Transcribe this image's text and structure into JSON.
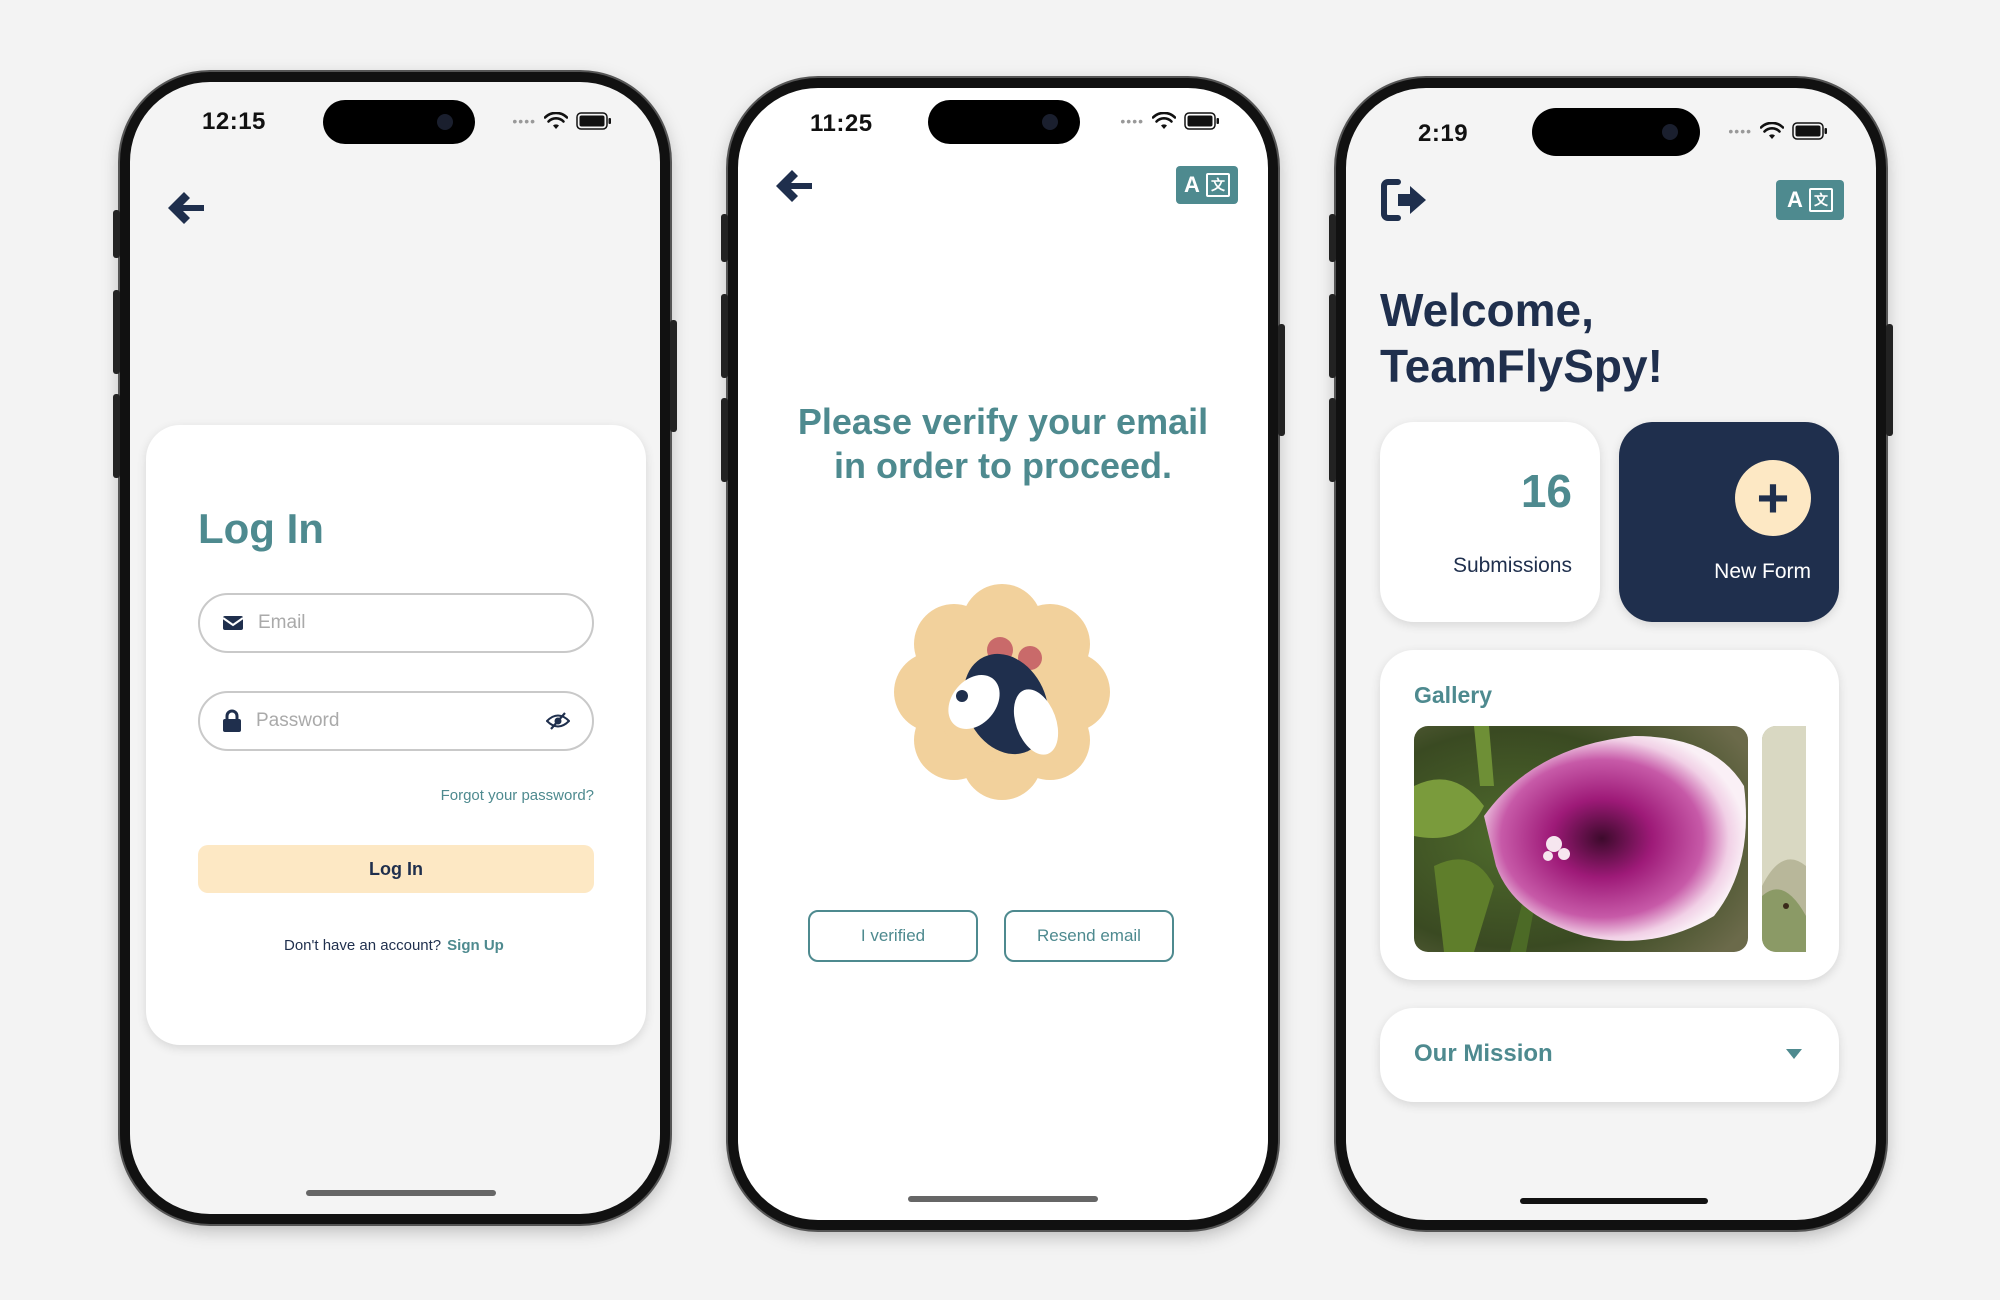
{
  "colors": {
    "teal": "#4e8a8f",
    "navy": "#1f2f4d",
    "cream": "#fde8c4",
    "page_bg": "#f3f3f3"
  },
  "login_screen": {
    "status_time": "12:15",
    "back_icon": "arrow-left-icon",
    "title": "Log In",
    "email_placeholder": "Email",
    "password_placeholder": "Password",
    "forgot_password": "Forgot your password?",
    "login_button": "Log In",
    "no_account_text": "Don't have an account?",
    "sign_up_link": "Sign Up"
  },
  "verify_screen": {
    "status_time": "11:25",
    "back_icon": "arrow-left-icon",
    "translate_icon": "translate-icon",
    "message": "Please verify your email in order to proceed.",
    "verified_button": "I verified",
    "resend_button": "Resend email"
  },
  "home_screen": {
    "status_time": "2:19",
    "logout_icon": "logout-icon",
    "translate_icon": "translate-icon",
    "welcome_line1": "Welcome,",
    "welcome_line2": "TeamFlySpy!",
    "submissions_count": "16",
    "submissions_label": "Submissions",
    "new_form_label": "New Form",
    "gallery_title": "Gallery",
    "mission_title": "Our Mission"
  }
}
